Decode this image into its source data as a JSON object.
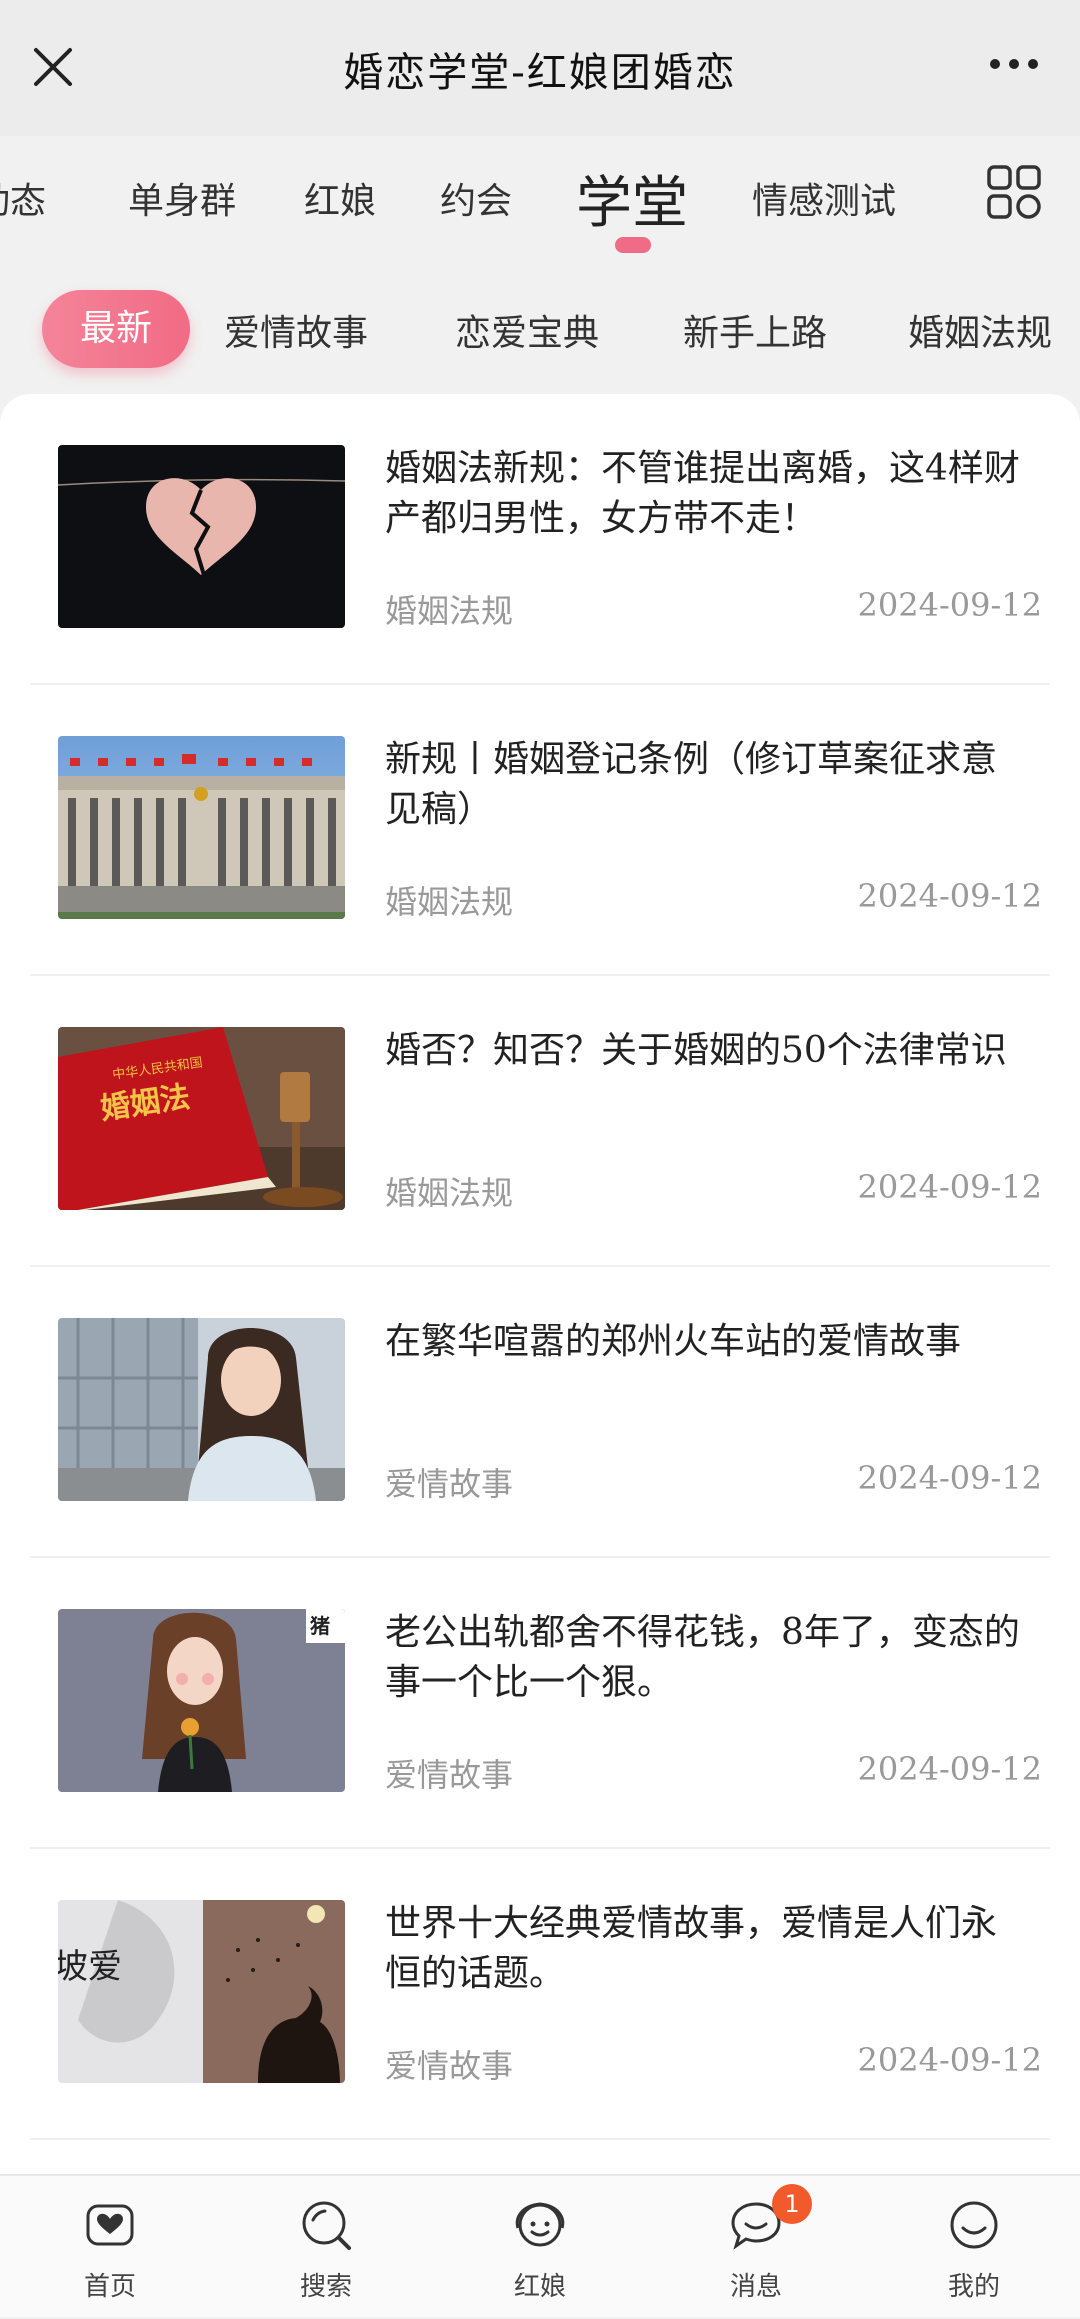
{
  "window": {
    "title": "婚恋学堂-红娘团婚恋",
    "close_icon": "close-icon",
    "more_icon": "more-icon"
  },
  "categories": [
    {
      "label": "动态"
    },
    {
      "label": "单身群"
    },
    {
      "label": "红娘"
    },
    {
      "label": "约会"
    },
    {
      "label": "学堂"
    },
    {
      "label": "情感测试"
    }
  ],
  "active_category": "学堂",
  "subtabs": [
    {
      "label": "最新"
    },
    {
      "label": "爱情故事"
    },
    {
      "label": "恋爱宝典"
    },
    {
      "label": "新手上路"
    },
    {
      "label": "婚姻法规"
    }
  ],
  "articles": [
    {
      "title": "婚姻法新规：不管谁提出离婚，这4样财产都归男性，女方带不走！",
      "category": "婚姻法规",
      "date": "2024-09-12"
    },
    {
      "title": "新规丨婚姻登记条例（修订草案征求意见稿）",
      "category": "婚姻法规",
      "date": "2024-09-12"
    },
    {
      "title": "婚否？知否？关于婚姻的50个法律常识",
      "category": "婚姻法规",
      "date": "2024-09-12"
    },
    {
      "title": "在繁华喧嚣的郑州火车站的爱情故事",
      "category": "爱情故事",
      "date": "2024-09-12"
    },
    {
      "title": "老公出轨都舍不得花钱，8年了，变态的事一个比一个狠。",
      "category": "爱情故事",
      "date": "2024-09-12"
    },
    {
      "title": "世界十大经典爱情故事，爱情是人们永恒的话题。",
      "category": "爱情故事",
      "date": "2024-09-12"
    }
  ],
  "thumbnail_text": {
    "law_book_line1": "中华人民共和国",
    "law_book_line2": "婚姻法",
    "brand_tag": "猪"
  },
  "bottom_nav": [
    {
      "label": "首页",
      "icon": "home-heart-icon"
    },
    {
      "label": "搜索",
      "icon": "search-icon"
    },
    {
      "label": "红娘",
      "icon": "matchmaker-icon"
    },
    {
      "label": "消息",
      "icon": "message-icon",
      "badge": "1"
    },
    {
      "label": "我的",
      "icon": "profile-icon"
    }
  ],
  "colors": {
    "accent": "#ef6b86",
    "badge": "#f25a2c"
  }
}
